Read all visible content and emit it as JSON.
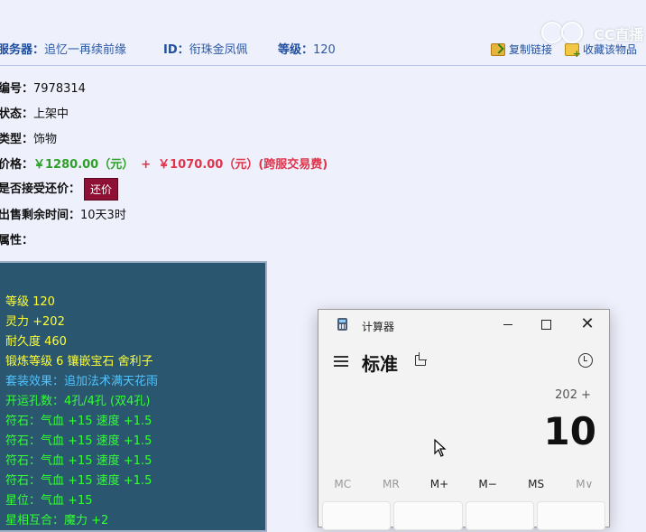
{
  "header": {
    "server_label": "服务器：",
    "server_value": "追忆一再续前缘",
    "id_label": "ID：",
    "id_value": "衔珠金凤佩",
    "level_label": "等级：",
    "level_value": "120",
    "copy_link": "复制链接",
    "favorite": "收藏该物品",
    "watermark": "CC直播"
  },
  "info": {
    "number_label": "编号：",
    "number_value": "7978314",
    "status_label": "状态：",
    "status_value": "上架中",
    "type_label": "类型：",
    "type_value": "饰物",
    "price_label": "价格：",
    "price_green": "￥1280.00（元）",
    "price_plus": "+",
    "price_red": "￥1070.00（元）(跨服交易费)",
    "haggle_label": "是否接受还价：",
    "haggle_button": "还价",
    "remaining_label": "出售剩余时间：",
    "remaining_value": "10天3时",
    "attr_label": "属性："
  },
  "attributes": [
    {
      "text": "等级 120",
      "color": "yellow"
    },
    {
      "text": "灵力 +202",
      "color": "yellow"
    },
    {
      "text": "耐久度 460",
      "color": "yellow"
    },
    {
      "text": "锻炼等级 6 镶嵌宝石 舍利子",
      "color": "yellow"
    },
    {
      "text": "套装效果：追加法术满天花雨",
      "color": "blue"
    },
    {
      "text": "开运孔数：4孔/4孔 (双4孔)",
      "color": "green"
    },
    {
      "text": "符石：气血 +15 速度 +1.5",
      "color": "green"
    },
    {
      "text": "符石：气血 +15 速度 +1.5",
      "color": "green"
    },
    {
      "text": "符石：气血 +15 速度 +1.5",
      "color": "green"
    },
    {
      "text": "符石：气血 +15 速度 +1.5",
      "color": "green"
    },
    {
      "text": "星位：气血 +15",
      "color": "green"
    },
    {
      "text": "星相互合：魔力 +2",
      "color": "green"
    }
  ],
  "calculator": {
    "title": "计算器",
    "mode": "标准",
    "expression": "202 +",
    "display": "10",
    "memory_buttons": [
      "MC",
      "MR",
      "M+",
      "M−",
      "MS",
      "M∨"
    ]
  }
}
